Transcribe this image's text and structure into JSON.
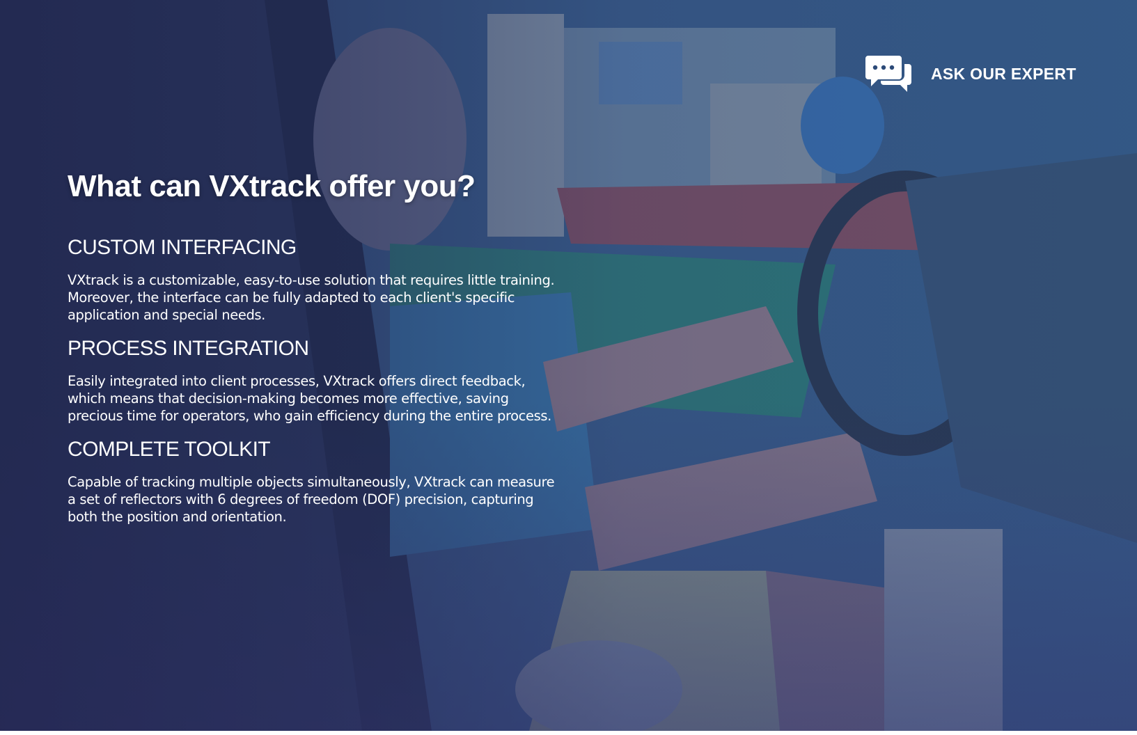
{
  "hero": {
    "title": "What can VXtrack offer you?"
  },
  "contact": {
    "label": "ASK OUR EXPERT",
    "icon": "chat-bubbles-icon"
  },
  "features": [
    {
      "heading": "CUSTOM INTERFACING",
      "body": "VXtrack is a customizable, easy-to-use solution that requires little training. Moreover, the interface can be fully adapted to each client's specific application and special needs."
    },
    {
      "heading": "PROCESS INTEGRATION",
      "body": "Easily integrated into client processes, VXtrack offers direct feedback, which means that decision-making becomes more effective, saving precious time for operators, who gain efficiency during the entire process."
    },
    {
      "heading": "COMPLETE TOOLKIT",
      "body": "Capable of tracking multiple objects simultaneously, VXtrack can measure a set of reflectors with 6 degrees of freedom (DOF) precision, capturing both the position and orientation."
    }
  ],
  "colors": {
    "text": "#ffffff",
    "overlay_left": "#232c52",
    "overlay_right": "#2c6a99"
  }
}
